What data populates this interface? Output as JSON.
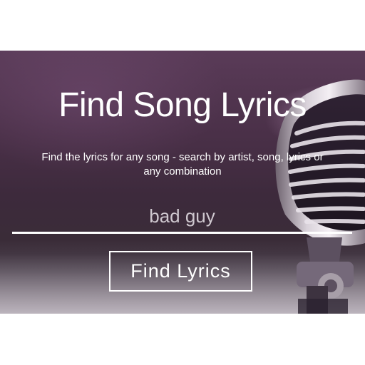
{
  "hero": {
    "title": "Find Song Lyrics",
    "subtitle": "Find the lyrics for any song - search by artist, song, lyrics or any combination"
  },
  "search": {
    "value": "bad guy",
    "placeholder": ""
  },
  "actions": {
    "find_label": "Find Lyrics"
  },
  "colors": {
    "hero_background": "#4a3048",
    "text": "#ffffff",
    "input_text": "#cfc8cf"
  }
}
